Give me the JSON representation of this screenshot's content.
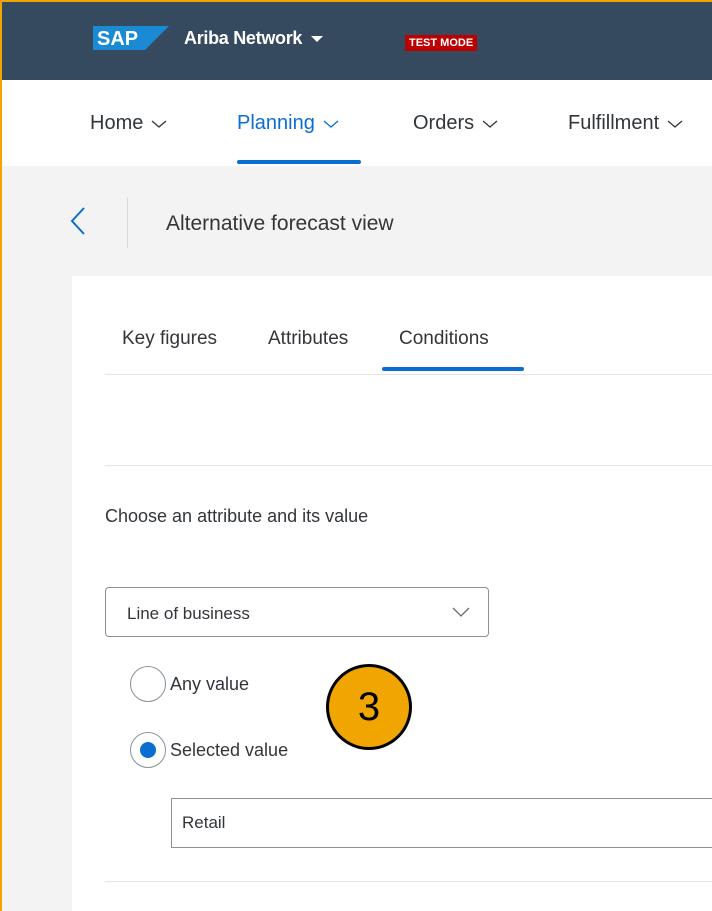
{
  "shell": {
    "logo_text": "SAP",
    "network_name": "Ariba Network",
    "mode_badge": "TEST MODE",
    "brand_color": "#354a5f"
  },
  "nav": {
    "items": [
      {
        "label": "Home",
        "active": false
      },
      {
        "label": "Planning",
        "active": true
      },
      {
        "label": "Orders",
        "active": false
      },
      {
        "label": "Fulfillment",
        "active": false
      }
    ],
    "accent": "#0a6ed1"
  },
  "header": {
    "title": "Alternative forecast view"
  },
  "tabs": [
    {
      "label": "Key figures",
      "active": false
    },
    {
      "label": "Attributes",
      "active": false
    },
    {
      "label": "Conditions",
      "active": true
    }
  ],
  "conditions": {
    "instruction": "Choose an attribute and its value",
    "attribute_select": {
      "value": "Line of business"
    },
    "radio_any": {
      "label": "Any value",
      "checked": false
    },
    "radio_selected": {
      "label": "Selected value",
      "checked": true
    },
    "value_field": {
      "value": "Retail"
    }
  },
  "annotation": {
    "step_number": "3",
    "color": "#f0a500"
  }
}
